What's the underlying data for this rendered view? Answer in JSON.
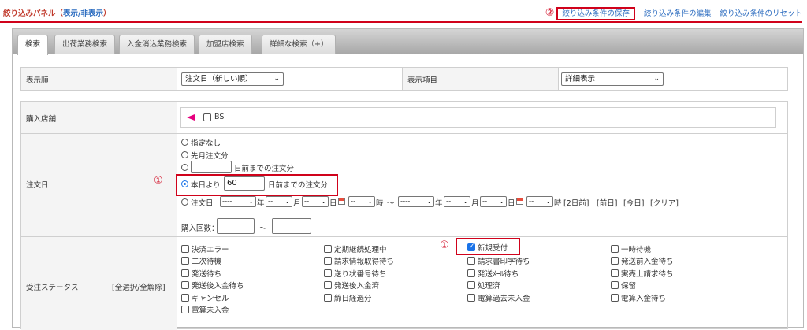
{
  "header": {
    "panel_title": "絞り込みパネル（",
    "panel_toggle": "表示/非表示",
    "panel_title_close": "）",
    "annotation_2": "②",
    "save_link": "絞り込み条件の保存",
    "edit_link": "絞り込み条件の編集",
    "reset_link": "絞り込み条件のリセット"
  },
  "tabs": [
    {
      "label": "検索",
      "active": true
    },
    {
      "label": "出荷業務検索",
      "active": false
    },
    {
      "label": "入金消込業務検索",
      "active": false
    },
    {
      "label": "加盟店検索",
      "active": false
    },
    {
      "label": "詳細な検索（+）",
      "active": false
    }
  ],
  "display": {
    "order_label": "表示順",
    "order_value": "注文日（新しい順）",
    "items_label": "表示項目",
    "items_value": "詳細表示"
  },
  "shop": {
    "label": "購入店舗",
    "option": "BS"
  },
  "order_date": {
    "label": "注文日",
    "annotation_1": "①",
    "opt_none": "指定なし",
    "opt_last_month": "先月注文分",
    "opt_days_before_suffix": "日前までの注文分",
    "opt_from_today_prefix": "本日より",
    "from_today_value": "60",
    "opt_from_today_suffix": "日前までの注文分",
    "opt_range_prefix": "注文日",
    "year_ph": "----",
    "month_ph": "--",
    "unit_year": "年",
    "unit_month": "月",
    "unit_day": "日",
    "unit_hour": "時",
    "tilde": "〜",
    "link_2days": "[2日前]",
    "link_prev": "[前日]",
    "link_today": "[今日]",
    "link_clear": "[クリア]",
    "purchase_count_label": "購入回数：",
    "purchase_tilde": "〜"
  },
  "status": {
    "label": "受注ステータス",
    "toggle": "[全選択/全解除]",
    "annotation_1": "①",
    "col1": [
      "決済エラー",
      "二次待機",
      "発送待ち",
      "発送後入金待ち",
      "キャンセル",
      "電算未入金"
    ],
    "col2": [
      "定期継続処理中",
      "請求情報取得待ち",
      "送り状番号待ち",
      "発送後入金済",
      "締日経過分"
    ],
    "col3": [
      "新規受付",
      "請求書印字待ち",
      "発送ﾒｰﾙ待ち",
      "処理済",
      "電算過去未入金"
    ],
    "col4": [
      "一時待機",
      "発送前入金待ち",
      "実売上請求待ち",
      "保留",
      "電算入金待ち"
    ],
    "checked": "新規受付"
  }
}
